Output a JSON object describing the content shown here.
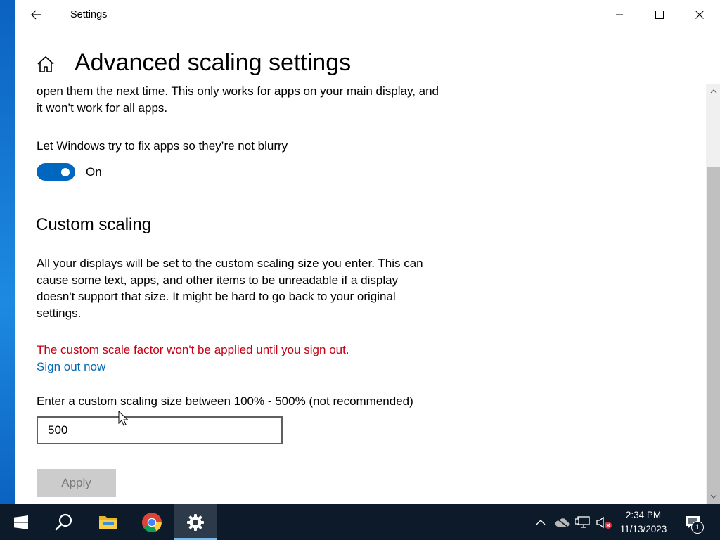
{
  "window": {
    "title": "Settings"
  },
  "page": {
    "title": "Advanced scaling settings"
  },
  "blurry_fix": {
    "description": "open them the next time. This only works for apps on your main display, and it won’t work for all apps.",
    "label": "Let Windows try to fix apps so they’re not blurry",
    "toggle_state": "On",
    "toggle_on": true
  },
  "custom_scaling": {
    "heading": "Custom scaling",
    "description": "All your displays will be set to the custom scaling size you enter. This can cause some text, apps, and other items to be unreadable if a display doesn't support that size. It might be hard to go back to your original settings.",
    "warning": "The custom scale factor won't be applied until you sign out.",
    "sign_out_link": "Sign out now",
    "input_label": "Enter a custom scaling size between 100% - 500% (not recommended)",
    "input_value": "500",
    "apply_label": "Apply"
  },
  "taskbar": {
    "time": "2:34 PM",
    "date": "11/13/2023",
    "notification_count": "1"
  },
  "colors": {
    "accent": "#0067c0",
    "warning": "#c40012",
    "link": "#0069b8"
  }
}
